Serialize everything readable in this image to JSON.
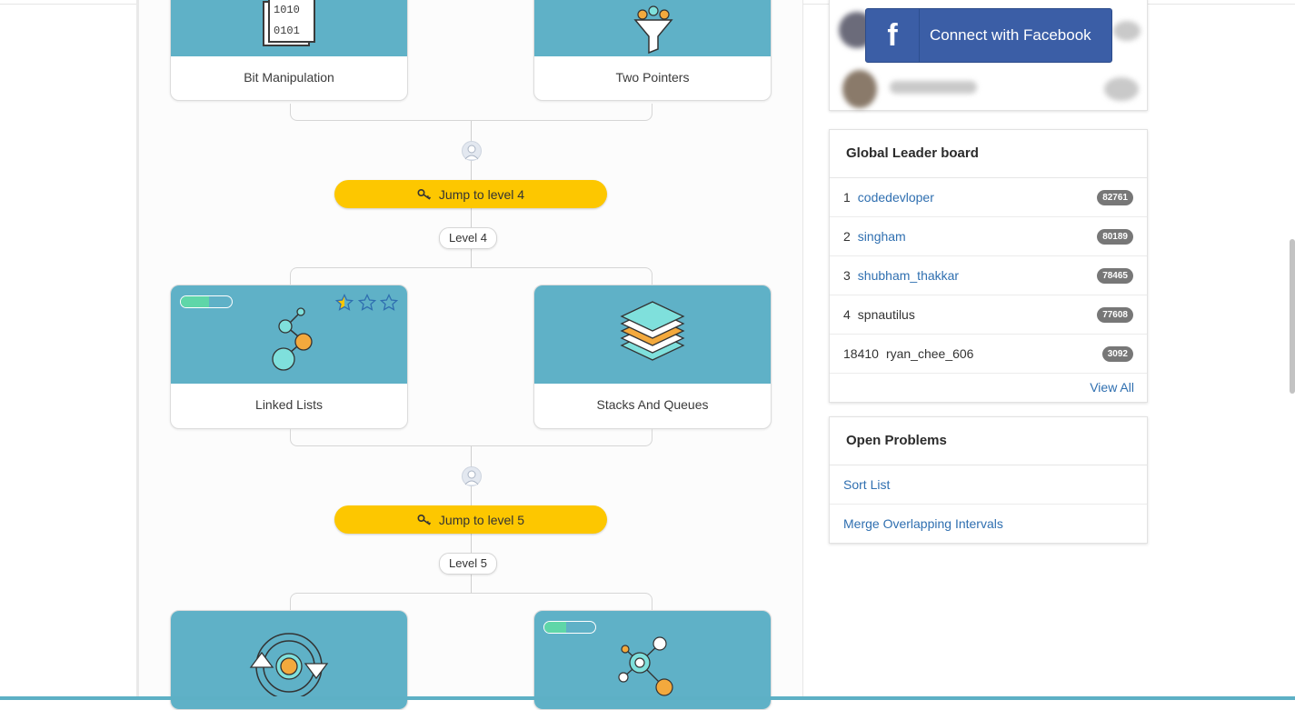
{
  "level_sections": [
    {
      "jump_label": "Jump to level 4",
      "level_label": "Level 4",
      "cards": [
        {
          "label": "Linked Lists",
          "progress": 0.55,
          "stars_filled": 0.5,
          "stars_total": 3
        },
        {
          "label": "Stacks And Queues"
        }
      ]
    },
    {
      "jump_label": "Jump to level 5",
      "level_label": "Level 5",
      "cards": [
        {
          "label": ""
        },
        {
          "label": "",
          "progress": 0.42
        }
      ]
    }
  ],
  "top_cards": [
    {
      "label": "Bit Manipulation",
      "icon": "binary-file-icon"
    },
    {
      "label": "Two Pointers",
      "icon": "funnel-icon"
    }
  ],
  "facebook": {
    "label": "Connect with Facebook",
    "logo": "f"
  },
  "leaderboard": {
    "title": "Global Leader board",
    "rows": [
      {
        "rank": "1",
        "name": "codedevloper",
        "score": "82761",
        "link": true
      },
      {
        "rank": "2",
        "name": "singham",
        "score": "80189",
        "link": true
      },
      {
        "rank": "3",
        "name": "shubham_thakkar",
        "score": "78465",
        "link": true
      },
      {
        "rank": "4",
        "name": "spnautilus",
        "score": "77608",
        "link": false
      },
      {
        "rank": "18410",
        "name": "ryan_chee_606",
        "score": "3092",
        "link": false
      }
    ],
    "view_all": "View All"
  },
  "open_problems": {
    "title": "Open Problems",
    "items": [
      "Sort List",
      "Merge Overlapping Intervals"
    ]
  },
  "colors": {
    "card_top": "#5fb1c7",
    "jump": "#fdc700",
    "facebook": "#3b5ea6",
    "link": "#2f6fb0"
  }
}
